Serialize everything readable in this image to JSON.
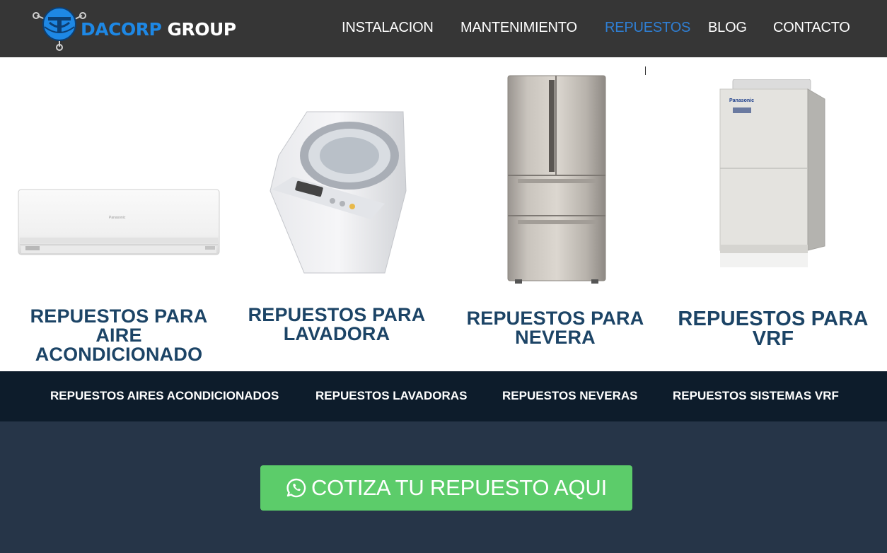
{
  "header": {
    "logo": {
      "part1": "DACORP",
      "part2": " GROUP",
      "icon": "logo-globe-icon"
    },
    "nav": [
      {
        "label": "INSTALACION",
        "active": false
      },
      {
        "label": "MANTENIMIENTO",
        "active": false
      },
      {
        "label": "REPUESTOS",
        "active": true
      },
      {
        "label": "BLOG",
        "active": false
      },
      {
        "label": "CONTACTO",
        "active": false
      }
    ]
  },
  "products": [
    {
      "title_lines": [
        "REPUESTOS PARA",
        "AIRE",
        "ACONDICIONADO"
      ],
      "brand": "Panasonic"
    },
    {
      "title_lines": [
        "REPUESTOS PARA",
        "LAVADORA"
      ]
    },
    {
      "title_lines": [
        "REPUESTOS PARA",
        "NEVERA"
      ]
    },
    {
      "title_lines": [
        "REPUESTOS PARA",
        "VRF"
      ],
      "brand": "Panasonic"
    }
  ],
  "subnav": [
    "REPUESTOS AIRES ACONDICIONADOS",
    "REPUESTOS LAVADORAS",
    "REPUESTOS NEVERAS",
    "REPUESTOS SISTEMAS VRF"
  ],
  "cta": {
    "label": "COTIZA TU REPUESTO AQUI",
    "icon": "whatsapp-icon"
  },
  "colors": {
    "header_bg": "#363636",
    "nav_active": "#2f7fd4",
    "title": "#1c4466",
    "subnav_bg": "#0d1c2b",
    "cta_section_bg": "#263548",
    "cta_button": "#5ccc6a"
  }
}
